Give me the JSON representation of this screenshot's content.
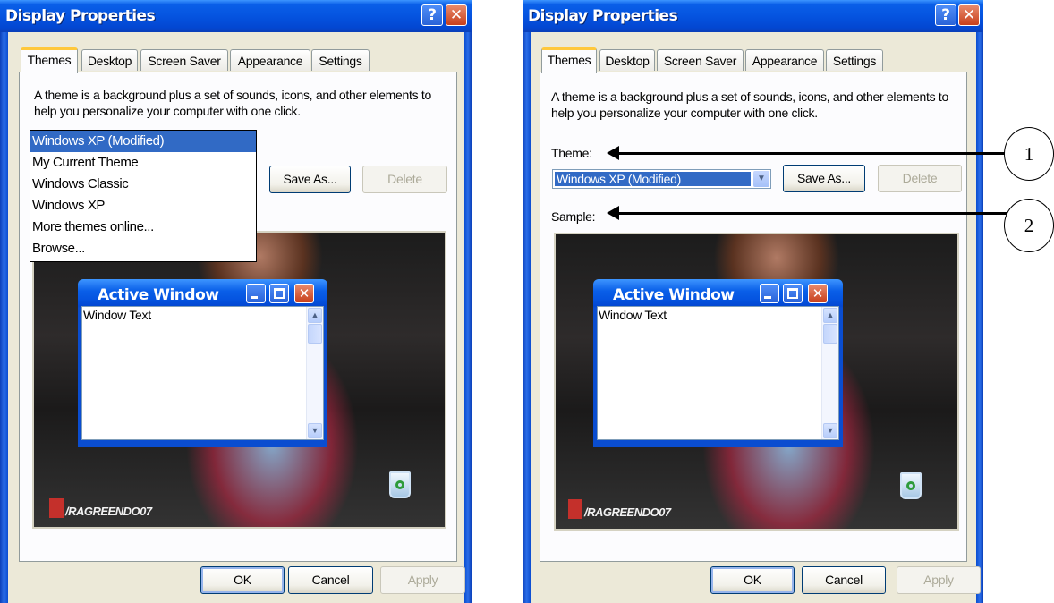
{
  "dialog": {
    "title": "Display Properties",
    "help_glyph": "?",
    "close_glyph": "✕",
    "tabs": [
      "Themes",
      "Desktop",
      "Screen Saver",
      "Appearance",
      "Settings"
    ],
    "description": "A theme is a background plus a set of sounds, icons, and other elements to help you personalize your computer with one click.",
    "theme_label": "Theme:",
    "theme_value": "Windows XP (Modified)",
    "sample_label": "Sample:",
    "save_as": "Save As...",
    "delete": "Delete",
    "ok": "OK",
    "cancel": "Cancel",
    "apply": "Apply"
  },
  "theme_dropdown": {
    "options": [
      "Windows XP (Modified)",
      "My Current Theme",
      "Windows Classic",
      "Windows XP",
      "More themes online...",
      "Browse..."
    ],
    "selected_index": 0
  },
  "sample_window": {
    "title": "Active Window",
    "body_text": "Window Text",
    "close_glyph": "✕"
  },
  "wallpaper_watermark": "/RAGREENDO07",
  "callouts": [
    "1",
    "2"
  ],
  "colors": {
    "titlebar_blue": "#0554e0",
    "selection_blue": "#316ac5",
    "dialog_face": "#ece9d8",
    "tab_highlight": "#ffc83c"
  }
}
